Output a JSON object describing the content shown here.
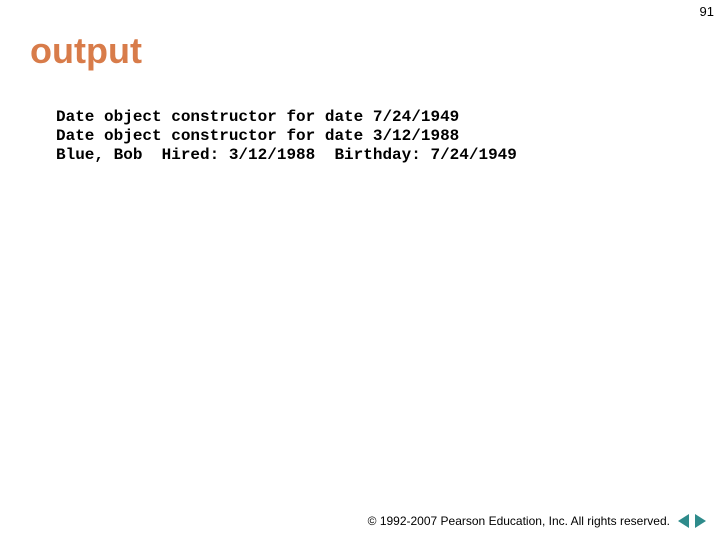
{
  "page_number": "91",
  "title": "output",
  "code": {
    "line1": "Date object constructor for date 7/24/1949",
    "line2": "Date object constructor for date 3/12/1988",
    "line3": "Blue, Bob  Hired: 3/12/1988  Birthday: 7/24/1949"
  },
  "footer": {
    "copyright": "© 1992-2007 Pearson Education, Inc. All rights reserved."
  }
}
